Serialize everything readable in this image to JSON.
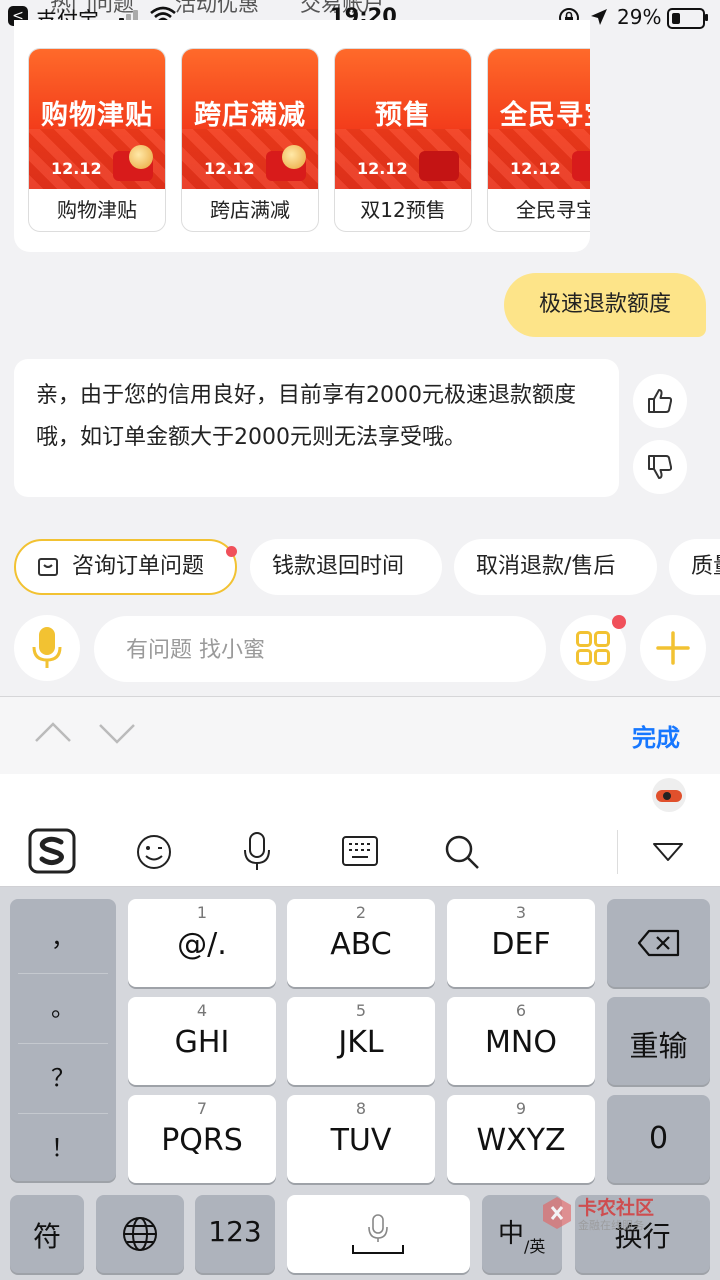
{
  "status_bar": {
    "back_glyph": "<",
    "carrier": "支付宝",
    "time": "19:20",
    "battery": "29%",
    "battery_level": 0.29,
    "hidden_tabs": [
      "热门问题",
      "活动优惠",
      "交易账户"
    ]
  },
  "promos": [
    {
      "title": "购物津贴",
      "date": "12.12",
      "label": "购物津贴"
    },
    {
      "title": "跨店满减",
      "date": "12.12",
      "label": "跨店满减"
    },
    {
      "title": "预售",
      "date": "12.12",
      "label": "双12预售"
    },
    {
      "title": "全民寻宝",
      "date": "12.12",
      "label": "全民寻宝"
    }
  ],
  "chat": {
    "user_message": "极速退款额度",
    "bot_message": "亲，由于您的信用良好，目前享有2000元极速退款额度哦，如订单金额大于2000元则无法享受哦。"
  },
  "chips": [
    "咨询订单问题",
    "钱款退回时间",
    "取消退款/售后",
    "质量问题"
  ],
  "input": {
    "placeholder": "有问题 找小蜜",
    "value": ""
  },
  "toolbar": {
    "done": "完成"
  },
  "keyboard": {
    "punctuation": [
      "，",
      "。",
      "？",
      "！"
    ],
    "keys": [
      {
        "num": "1",
        "letters": "@/."
      },
      {
        "num": "2",
        "letters": "ABC"
      },
      {
        "num": "3",
        "letters": "DEF"
      },
      {
        "num": "4",
        "letters": "GHI"
      },
      {
        "num": "5",
        "letters": "JKL"
      },
      {
        "num": "6",
        "letters": "MNO"
      },
      {
        "num": "7",
        "letters": "PQRS"
      },
      {
        "num": "8",
        "letters": "TUV"
      },
      {
        "num": "9",
        "letters": "WXYZ"
      }
    ],
    "retype": "重输",
    "zero": "0",
    "symbols": "符",
    "num_mode": "123",
    "lang_main": "中",
    "lang_sub": "/英",
    "enter": "换行"
  },
  "watermark": {
    "main": "卡农社区",
    "sub": "金融在线服务"
  },
  "colors": {
    "accent": "#f2c232",
    "user_bubble": "#fde489",
    "link": "#1677ff",
    "badge": "#f0505a",
    "promo": "#f23a1a"
  }
}
